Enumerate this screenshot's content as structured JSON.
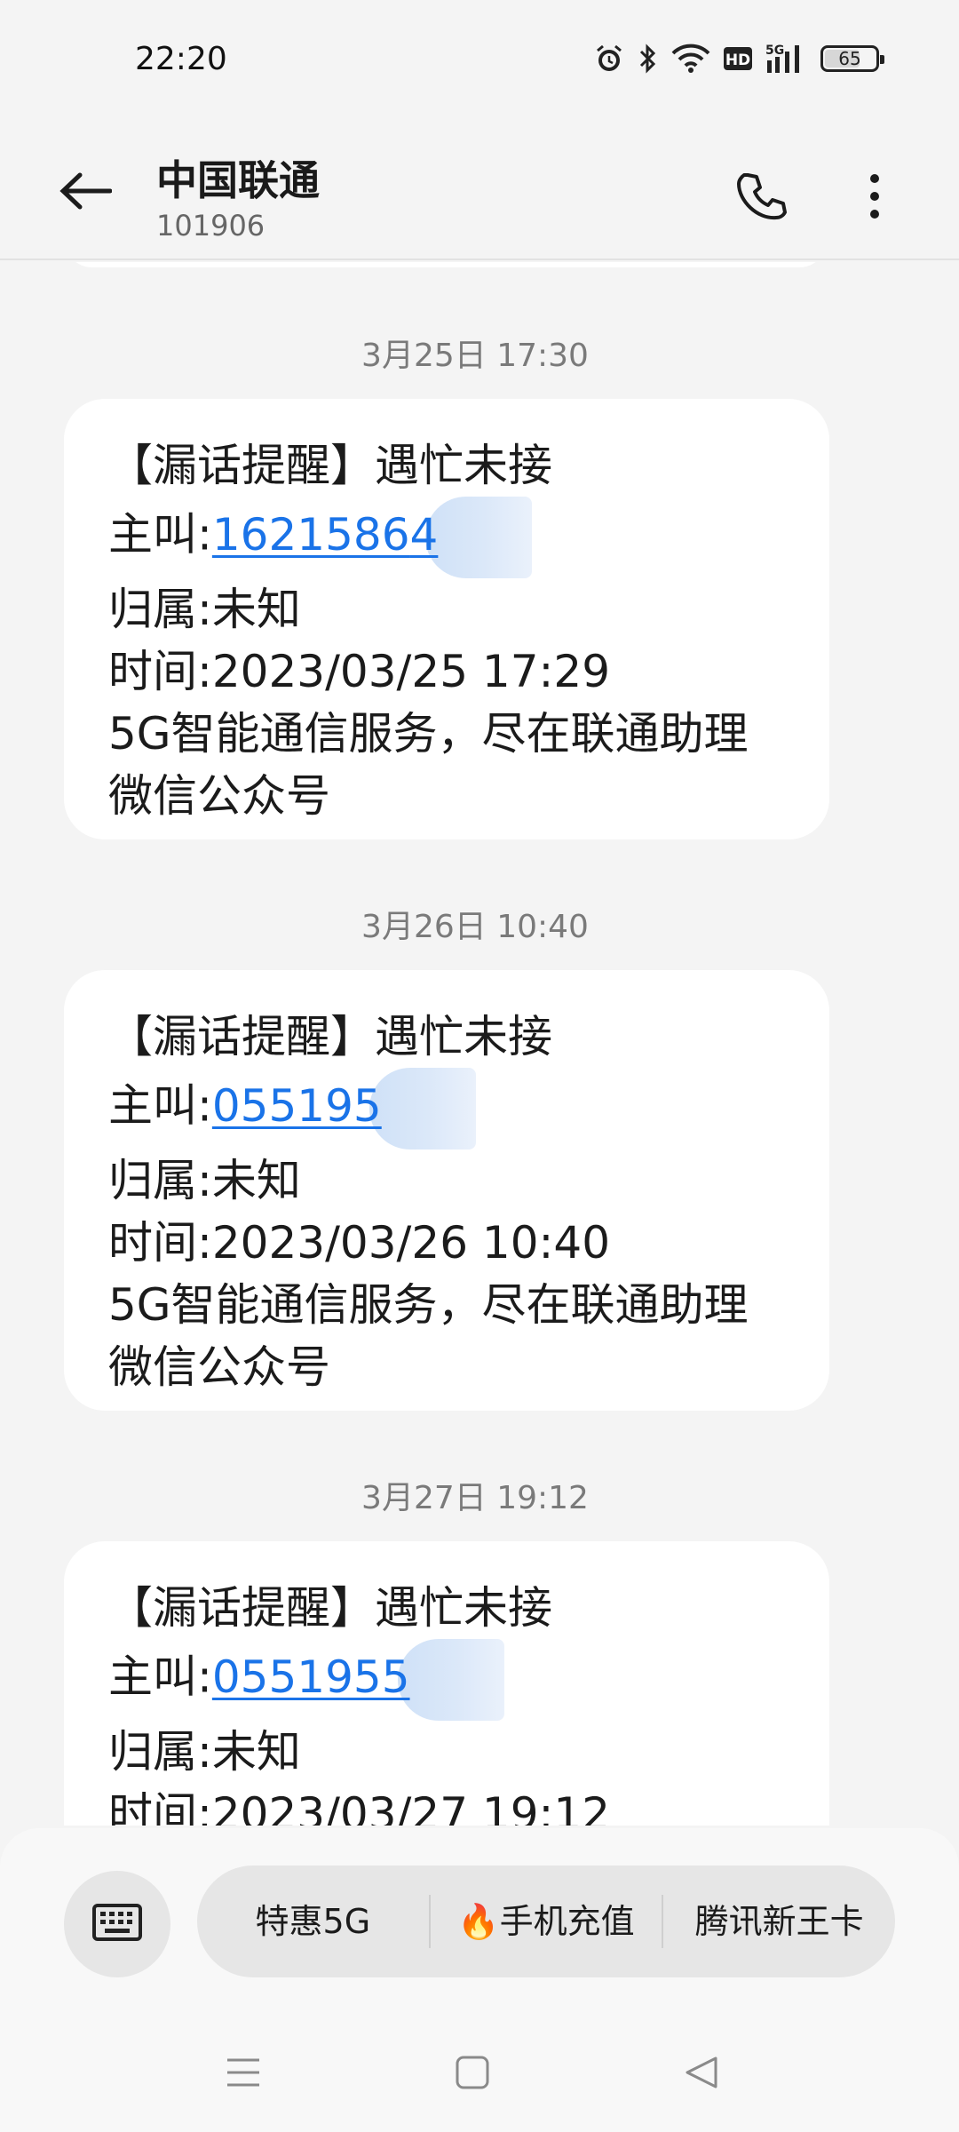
{
  "status_bar": {
    "time": "22:20",
    "icons": [
      "alarm-icon",
      "bluetooth-icon",
      "wifi-icon",
      "hd-icon",
      "5g-signal-icon"
    ],
    "network": "5G",
    "hd_label": "HD",
    "battery_level": "65"
  },
  "header": {
    "contact_name": "中国联通",
    "contact_number": "101906"
  },
  "messages": [
    {
      "timestamp": "3月25日 17:30",
      "title": "【漏话提醒】遇忙未接",
      "caller_label": "主叫:",
      "caller_number": "1621586",
      "caller_partial_char": "4",
      "region": "归属:未知",
      "time": "时间:2023/03/25 17:29",
      "service": "5G智能通信服务，尽在联通助理微信公众号"
    },
    {
      "timestamp": "3月26日 10:40",
      "title": "【漏话提醒】遇忙未接",
      "caller_label": "主叫:",
      "caller_number": "055195",
      "caller_partial_char": "",
      "region": "归属:未知",
      "time": "时间:2023/03/26 10:40",
      "service": "5G智能通信服务，尽在联通助理微信公众号"
    },
    {
      "timestamp": "3月27日 19:12",
      "title": "【漏话提醒】遇忙未接",
      "caller_label": "主叫:",
      "caller_number": "0551955",
      "caller_partial_char": "",
      "region": "归属:未知",
      "time": "时间:2023/03/27 19:12"
    }
  ],
  "quick_replies": [
    "特惠5G",
    "🔥手机充值",
    "腾讯新王卡"
  ],
  "colors": {
    "link": "#1a73e8",
    "background": "#f4f4f4",
    "bubble": "#ffffff"
  }
}
